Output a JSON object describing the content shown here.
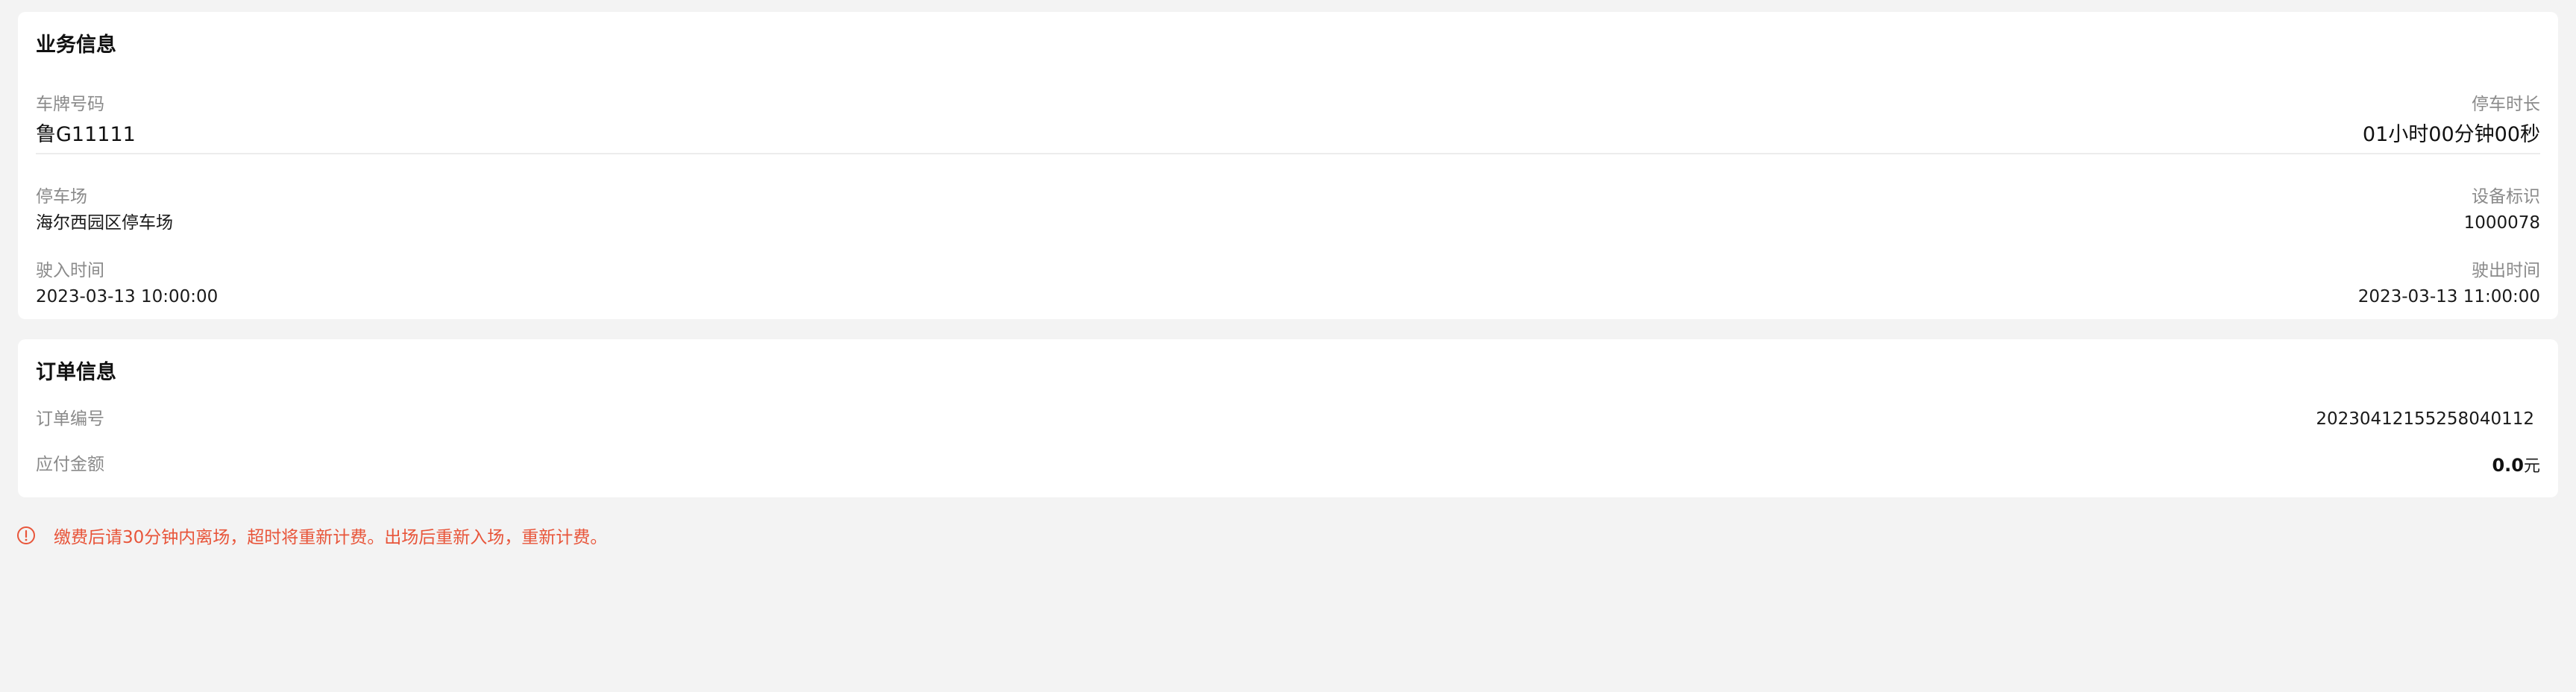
{
  "business": {
    "title": "业务信息",
    "plate_label": "车牌号码",
    "plate_value": "鲁G11111",
    "duration_label": "停车时长",
    "duration_value": "01小时00分钟00秒",
    "lot_label": "停车场",
    "lot_value": "海尔西园区停车场",
    "device_label": "设备标识",
    "device_value": "1000078",
    "entry_label": "驶入时间",
    "entry_value": "2023-03-13 10:00:00",
    "exit_label": "驶出时间",
    "exit_value": "2023-03-13 11:00:00"
  },
  "order": {
    "title": "订单信息",
    "number_label": "订单编号",
    "number_value": "2023041215525804011​2",
    "amount_label": "应付金额",
    "amount_value": "0.0",
    "amount_unit": "元"
  },
  "notice": {
    "icon": "alert-circle-icon",
    "text": "缴费后请30分钟内离场，超时将重新计费。出场后重新入场，重新计费。",
    "color": "#e8553a"
  }
}
